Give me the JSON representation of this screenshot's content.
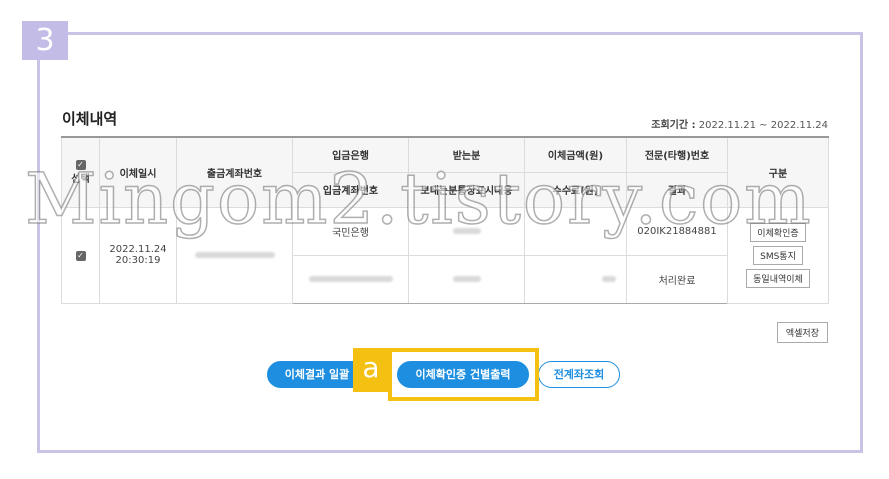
{
  "step": "3",
  "section_title": "이체내역",
  "period": {
    "label": "조회기간 :",
    "value": "2022.11.21 ~ 2022.11.24"
  },
  "table": {
    "headers": {
      "select": "선택",
      "datetime": "이체일시",
      "from_account": "출금계좌번호",
      "bank": "입금은행",
      "recipient": "받는분",
      "amount": "이체금액(원)",
      "message_no": "전문(타행)번호",
      "category": "구분",
      "to_account": "입금계좌번호",
      "display_text": "보내는분통장표시내용",
      "fee": "수수료(원)",
      "result": "결과"
    },
    "row": {
      "date": "2022.11.24",
      "time": "20:30:19",
      "bank": "국민은행",
      "message_no": "020IK21884881",
      "result": "처리완료",
      "btn_certificate": "이체확인증",
      "btn_sms": "SMS통지",
      "btn_repeat": "동일내역이체"
    }
  },
  "excel_button": "엑셀저장",
  "buttons": {
    "result_print": "이체결과 일괄",
    "confirm_print": "이체확인증 건별출력",
    "all_accounts": "전계좌조회"
  },
  "annotation": "a",
  "watermark": "Mingom2.tistory.com",
  "colors": {
    "frame": "#c9c3e6",
    "accent_blue": "#1e8fe0",
    "highlight": "#f4c012"
  }
}
